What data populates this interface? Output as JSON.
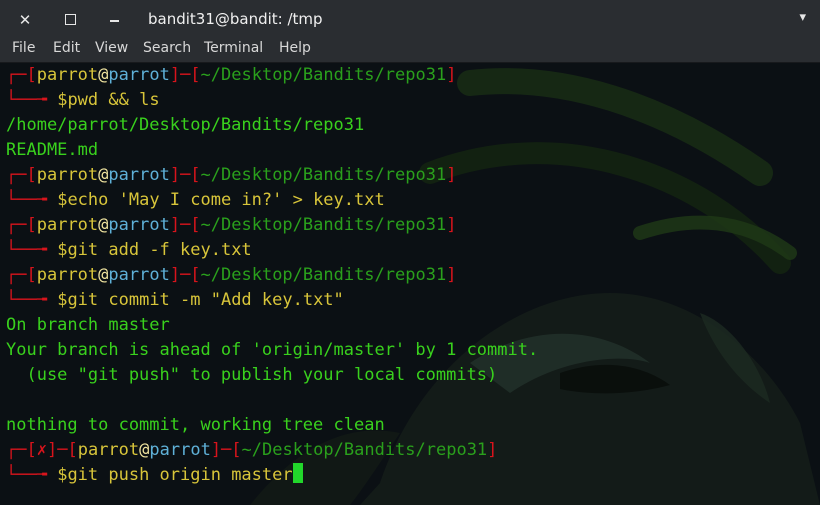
{
  "window": {
    "title": "bandit31@bandit: /tmp"
  },
  "menu": {
    "file": "File",
    "edit": "Edit",
    "view": "View",
    "search": "Search",
    "terminal": "Terminal",
    "help": "Help"
  },
  "prompt": {
    "user": "parrot",
    "at": "@",
    "host": "parrot",
    "path": "~/Desktop/Bandits/repo31",
    "dollar": "$",
    "error_mark": "✗"
  },
  "lines": [
    {
      "type": "prompt",
      "command": "pwd && ls"
    },
    {
      "type": "output",
      "text": "/home/parrot/Desktop/Bandits/repo31"
    },
    {
      "type": "output",
      "text": "README.md"
    },
    {
      "type": "prompt",
      "command": "echo 'May I come in?' > key.txt"
    },
    {
      "type": "prompt",
      "command": "git add -f key.txt"
    },
    {
      "type": "prompt",
      "command": "git commit -m \"Add key.txt\""
    },
    {
      "type": "output",
      "text": "On branch master"
    },
    {
      "type": "output",
      "text": "Your branch is ahead of 'origin/master' by 1 commit."
    },
    {
      "type": "output",
      "text": "  (use \"git push\" to publish your local commits)"
    },
    {
      "type": "output",
      "text": ""
    },
    {
      "type": "output",
      "text": "nothing to commit, working tree clean"
    },
    {
      "type": "prompt-error",
      "command": "git push origin master"
    }
  ],
  "colors": {
    "prompt_red": "#d8141c",
    "command_yellow": "#d8c53a",
    "output_green": "#39d11d",
    "host_blue": "#5fb1d8"
  }
}
